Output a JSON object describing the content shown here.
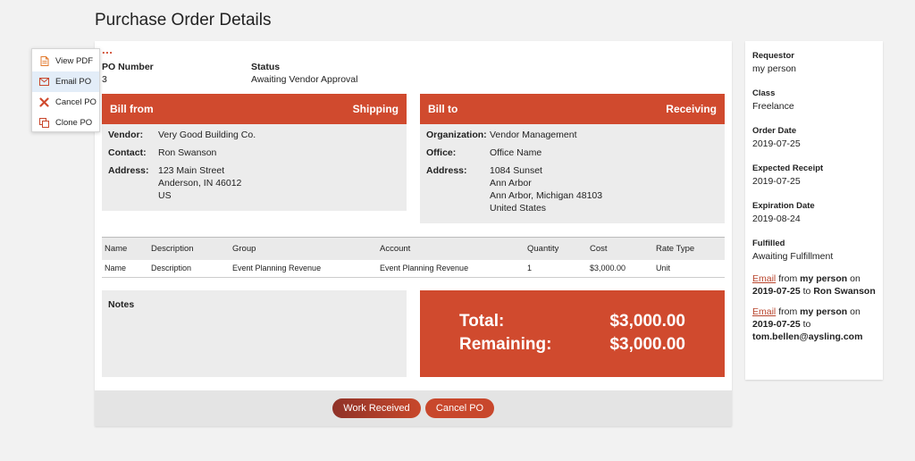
{
  "page": {
    "title": "Purchase Order Details"
  },
  "menu": {
    "more": "...",
    "items": [
      {
        "label": "View PDF",
        "icon": "pdf-icon"
      },
      {
        "label": "Email PO",
        "icon": "email-icon"
      },
      {
        "label": "Cancel PO",
        "icon": "cancel-icon"
      },
      {
        "label": "Clone PO",
        "icon": "clone-icon"
      }
    ]
  },
  "po": {
    "number_label": "PO Number",
    "number": "3",
    "status_label": "Status",
    "status": "Awaiting Vendor Approval"
  },
  "bill_from": {
    "title": "Bill from",
    "subtitle": "Shipping",
    "vendor_label": "Vendor:",
    "vendor": "Very Good Building Co.",
    "contact_label": "Contact:",
    "contact": "Ron Swanson",
    "address_label": "Address:",
    "address_lines": [
      "123 Main Street",
      "Anderson, IN 46012",
      "US"
    ]
  },
  "bill_to": {
    "title": "Bill to",
    "subtitle": "Receiving",
    "org_label": "Organization:",
    "org": "Vendor Management",
    "office_label": "Office:",
    "office": "Office Name",
    "address_label": "Address:",
    "address_lines": [
      "1084 Sunset",
      "Ann Arbor",
      "Ann Arbor, Michigan 48103",
      "United States"
    ]
  },
  "items_table": {
    "columns": [
      "Name",
      "Description",
      "Group",
      "Account",
      "Quantity",
      "Cost",
      "Rate Type"
    ],
    "rows": [
      [
        "Name",
        "Description",
        "Event Planning Revenue",
        "Event Planning Revenue",
        "1",
        "$3,000.00",
        "Unit"
      ]
    ]
  },
  "notes": {
    "label": "Notes"
  },
  "totals": {
    "total_label": "Total:",
    "total": "$3,000.00",
    "remaining_label": "Remaining:",
    "remaining": "$3,000.00"
  },
  "actions": {
    "work_received": "Work Received",
    "cancel_po": "Cancel PO"
  },
  "sidebar": {
    "requestor_label": "Requestor",
    "requestor": "my person",
    "class_label": "Class",
    "class": "Freelance",
    "order_date_label": "Order Date",
    "order_date": "2019-07-25",
    "expected_receipt_label": "Expected Receipt",
    "expected_receipt": "2019-07-25",
    "expiration_date_label": "Expiration Date",
    "expiration_date": "2019-08-24",
    "fulfilled_label": "Fulfilled",
    "fulfilled": "Awaiting Fulfillment",
    "email_log": [
      {
        "link": "Email",
        "from_word": "from",
        "sender": "my person",
        "on_word": "on",
        "date": "2019-07-25",
        "to_word": "to",
        "recipient": "Ron Swanson"
      },
      {
        "link": "Email",
        "from_word": "from",
        "sender": "my person",
        "on_word": "on",
        "date": "2019-07-25",
        "to_word": "to",
        "recipient": "tom.bellen@aysling.com"
      }
    ]
  },
  "colors": {
    "accent": "#d04a2e",
    "link": "#b8452d",
    "panel_bg": "#ececec",
    "page_bg": "#f2f2f2"
  }
}
